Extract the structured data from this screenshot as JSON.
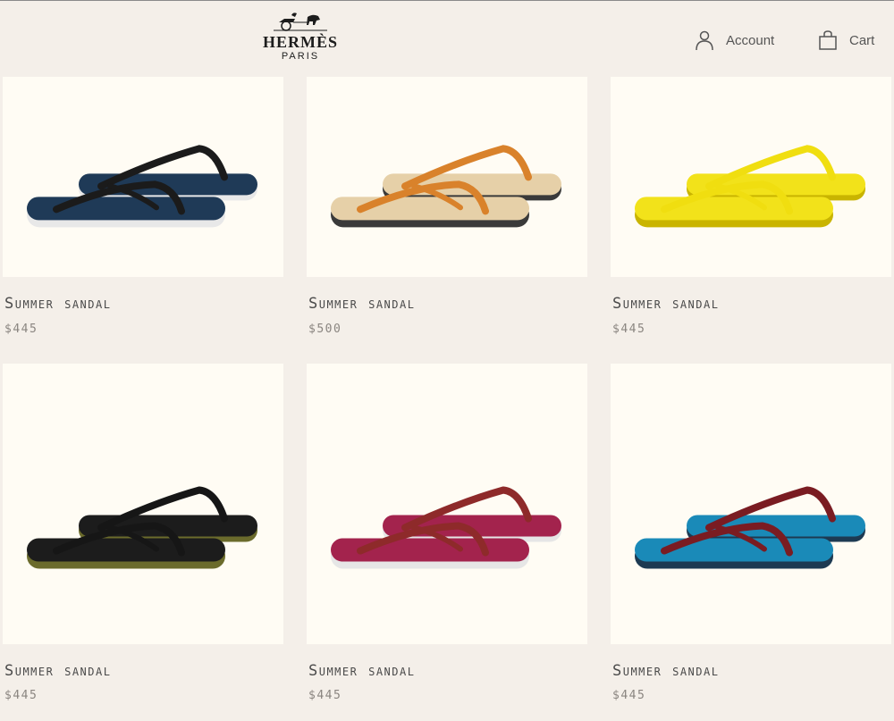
{
  "header": {
    "brand": "HERMÈS",
    "city": "PARIS",
    "account_label": "Account",
    "cart_label": "Cart"
  },
  "products": [
    {
      "name": "Summer sandal",
      "price": "$445",
      "sole_color": "#1f3a57",
      "strap_color": "#1b1b1b",
      "edge_color": "#e8e8e8"
    },
    {
      "name": "Summer sandal",
      "price": "$500",
      "sole_color": "#e6d0a8",
      "strap_color": "#d9822b",
      "edge_color": "#3a3a3a"
    },
    {
      "name": "Summer sandal",
      "price": "$445",
      "sole_color": "#f2e21a",
      "strap_color": "#f0de10",
      "edge_color": "#c9b400"
    },
    {
      "name": "Summer sandal",
      "price": "$445",
      "sole_color": "#1c1c1c",
      "strap_color": "#161616",
      "edge_color": "#6b6b2c"
    },
    {
      "name": "Summer sandal",
      "price": "$445",
      "sole_color": "#a3234d",
      "strap_color": "#8e2a2a",
      "edge_color": "#e6e6e6"
    },
    {
      "name": "Summer sandal",
      "price": "$445",
      "sole_color": "#1a8ab8",
      "strap_color": "#7a1c22",
      "edge_color": "#1d3a52"
    }
  ]
}
